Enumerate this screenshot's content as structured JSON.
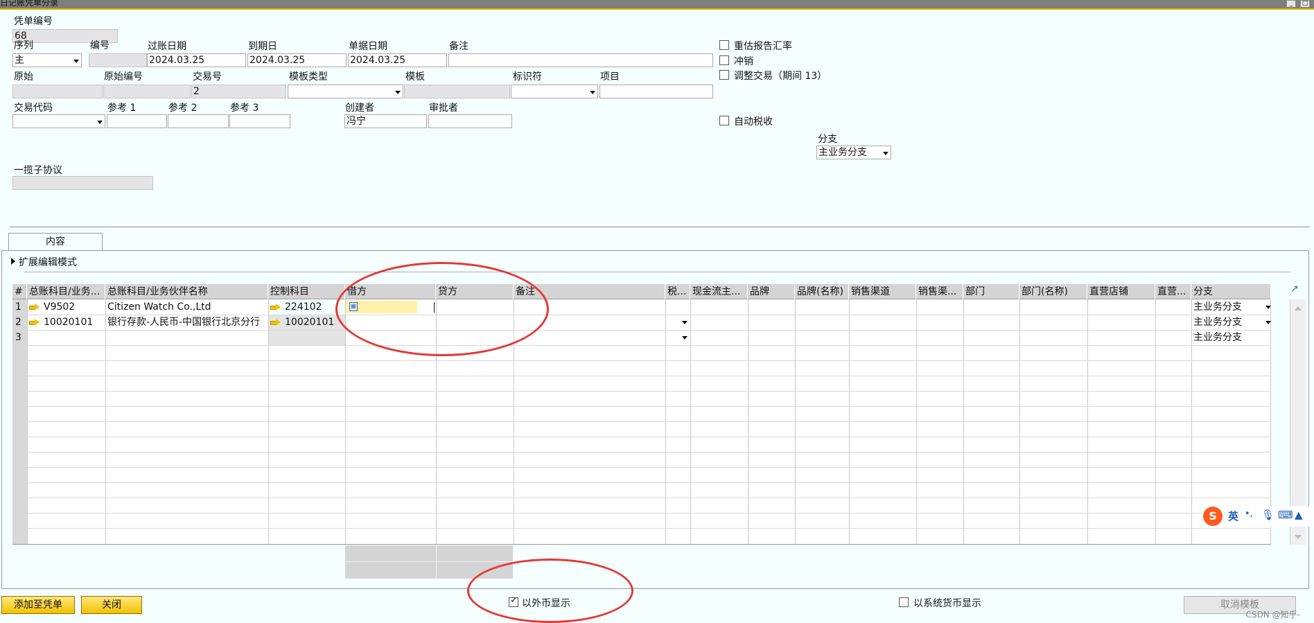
{
  "window": {
    "title": "日记账凭单分录"
  },
  "header": {
    "voucher_no_label": "凭单编号",
    "voucher_no_value": "68",
    "series_label": "序列",
    "series_value": "主",
    "number_label": "编号",
    "posting_date_label": "过账日期",
    "posting_date_value": "2024.03.25",
    "due_date_label": "到期日",
    "due_date_value": "2024.03.25",
    "doc_date_label": "单据日期",
    "doc_date_value": "2024.03.25",
    "remarks_label": "备注",
    "origin_label": "原始",
    "origin_no_label": "原始编号",
    "trans_no_label": "交易号",
    "trans_no_value": "2",
    "template_type_label": "模板类型",
    "template_label": "模板",
    "indicator_label": "标识符",
    "project_label": "项目",
    "trans_code_label": "交易代码",
    "ref1_label": "参考 1",
    "ref2_label": "参考 2",
    "ref3_label": "参考 3",
    "creator_label": "创建者",
    "creator_value": "冯宁",
    "approver_label": "审批者",
    "blanket_label": "一揽子协议",
    "branch_label": "分支",
    "branch_value": "主业务分支",
    "checkboxes": {
      "revalue": "重估报告汇率",
      "reverse": "冲销",
      "adjust": "调整交易（期间 13）",
      "auto_tax": "自动税收"
    }
  },
  "tab": {
    "label": "内容"
  },
  "expand_label": "扩展编辑模式",
  "grid": {
    "columns": [
      "#",
      "总账科目/业务...",
      "总账科目/业务伙伴名称",
      "控制科目",
      "借方",
      "贷方",
      "备注",
      "税...",
      "现金流主...",
      "品牌",
      "品牌(名称)",
      "销售渠道",
      "销售渠...",
      "部门",
      "部门(名称)",
      "直营店铺",
      "直营...",
      "分支"
    ],
    "rows": [
      {
        "num": "1",
        "account": "V9502",
        "name": "Citizen Watch Co.,Ltd",
        "control": "224102",
        "branch": "主业务分支"
      },
      {
        "num": "2",
        "account": "10020101",
        "name": "银行存款-人民币-中国银行北京分行",
        "control": "10020101",
        "branch": "主业务分支"
      },
      {
        "num": "3",
        "account": "",
        "name": "",
        "control": "",
        "branch": "主业务分支"
      }
    ]
  },
  "footer": {
    "fc_display_label": "以外币显示",
    "fc_display_checked": true,
    "sc_display_label": "以系统货币显示",
    "sc_display_checked": false,
    "add_button": "添加至凭单",
    "close_button": "关闭",
    "cancel_template_button": "取消模板"
  },
  "ime": {
    "lang": "英"
  },
  "watermark": "CSDN @知乎-",
  "colors": {
    "accent": "#f2c200",
    "annotation": "#e53935",
    "background": "#f5ffff"
  }
}
